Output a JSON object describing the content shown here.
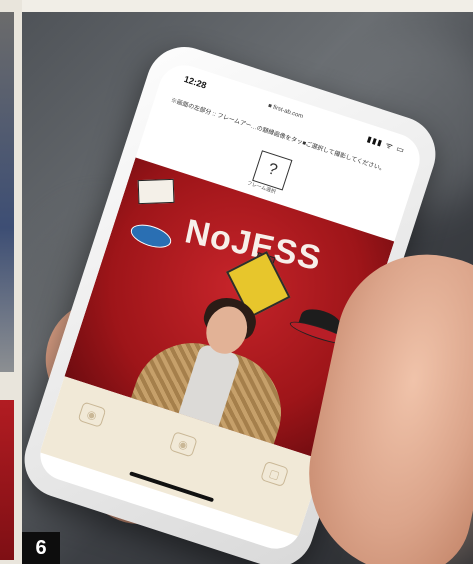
{
  "page_number": "6",
  "phone": {
    "status_time": "12:28",
    "status_url": "■ first-ab.com",
    "status_icons": "▮▮▮ ᯤ ▭",
    "instructions": "※画面の左部分 :: フレームアー…の額縁画像をタッ■ご選択して撮影してください。",
    "qr_label": "フレーム選択",
    "banner_text": "NoJESS"
  }
}
